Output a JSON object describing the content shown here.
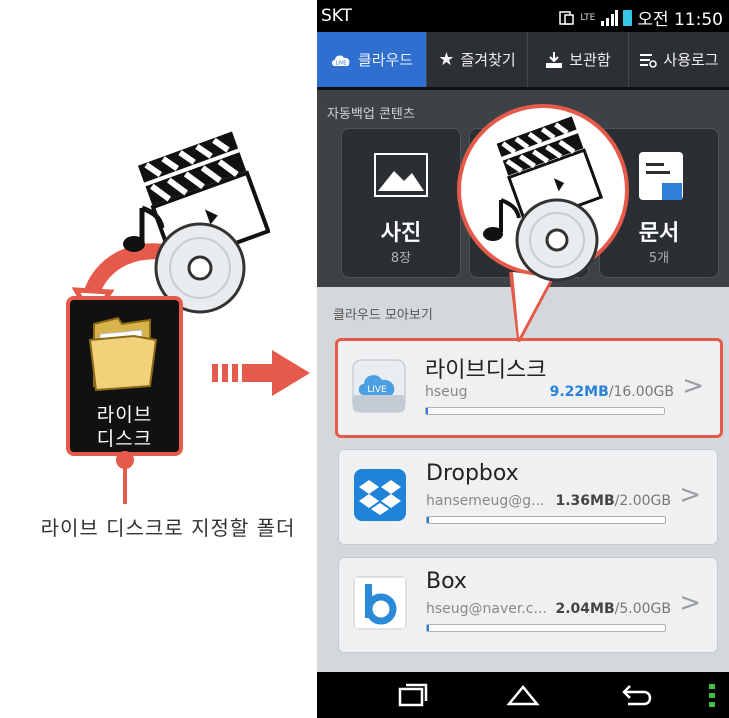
{
  "left": {
    "folder_label_line1": "라이브",
    "folder_label_line2": "디스크",
    "caption": "라이브 디스크로 지정할 폴더"
  },
  "status_bar": {
    "carrier": "SKT",
    "network": "LTE",
    "time": "오전 11:50"
  },
  "tabs": [
    {
      "label": "클라우드",
      "icon": "cloud-live-icon",
      "active": true
    },
    {
      "label": "즐겨찾기",
      "icon": "star-icon",
      "active": false
    },
    {
      "label": "보관함",
      "icon": "download-tray-icon",
      "active": false
    },
    {
      "label": "사용로그",
      "icon": "list-log-icon",
      "active": false
    }
  ],
  "auto_backup": {
    "title": "자동백업 콘텐츠",
    "tiles": [
      {
        "title": "사진",
        "count": "8장",
        "icon": "image-icon"
      },
      {
        "title": "",
        "count": "",
        "icon": "media-icon"
      },
      {
        "title": "문서",
        "count": "5개",
        "icon": "document-icon"
      }
    ]
  },
  "cloud_overview": {
    "title": "클라우드 모아보기",
    "services": [
      {
        "name": "라이브디스크",
        "account": "hseug",
        "used": "9.22MB",
        "total": "/16.00GB",
        "usage_fraction": 0.006,
        "icon": "live-cloud-icon",
        "highlighted": true
      },
      {
        "name": "Dropbox",
        "account": "hansemeug@g...",
        "used": "1.36MB",
        "total": "/2.00GB",
        "usage_fraction": 0.006,
        "icon": "dropbox-icon",
        "highlighted": false
      },
      {
        "name": "Box",
        "account": "hseug@naver.c...",
        "used": "2.04MB",
        "total": "/5.00GB",
        "usage_fraction": 0.006,
        "icon": "box-icon",
        "highlighted": false
      }
    ]
  },
  "colors": {
    "accent_red": "#e55a4a",
    "tab_active": "#2e6fd0",
    "usage_blue": "#2a82d8"
  }
}
